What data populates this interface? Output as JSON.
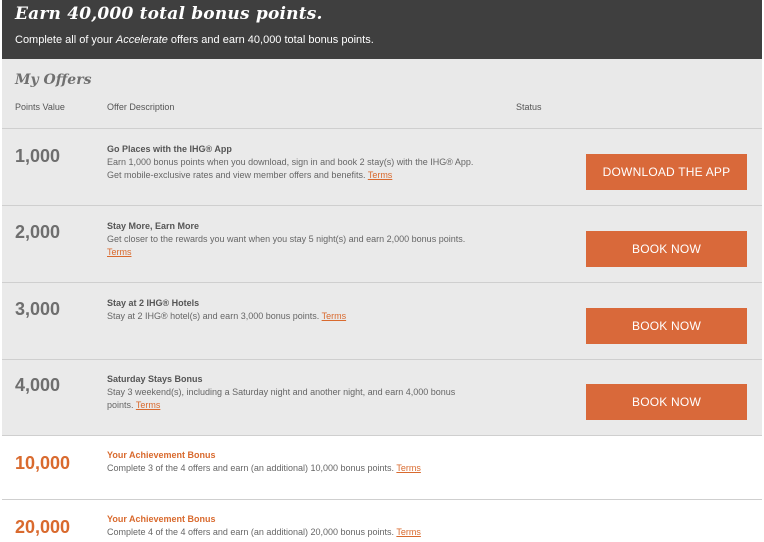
{
  "hero": {
    "title": "Earn 40,000 total bonus points.",
    "subtitle_pre": "Complete all of your ",
    "subtitle_em": "Accelerate",
    "subtitle_post": " offers and earn 40,000 total bonus points."
  },
  "offers": {
    "heading": "My Offers",
    "columns": {
      "points": "Points Value",
      "description": "Offer Description",
      "status": "Status"
    },
    "terms_label": "Terms",
    "rows": [
      {
        "points": "1,000",
        "title": "Go Places with the IHG® App",
        "description": "Earn 1,000 bonus points when you download, sign in and book 2 stay(s) with the IHG® App. Get mobile-exclusive rates and view member offers and benefits.",
        "button": "Download the App"
      },
      {
        "points": "2,000",
        "title": "Stay More, Earn More",
        "description": "Get closer to the rewards you want when you stay 5 night(s) and earn 2,000 bonus points.",
        "button": "Book Now"
      },
      {
        "points": "3,000",
        "title": "Stay at 2 IHG® Hotels",
        "description": "Stay at 2 IHG® hotel(s) and earn 3,000 bonus points.",
        "button": "Book Now"
      },
      {
        "points": "4,000",
        "title": "Saturday Stays Bonus",
        "description": "Stay 3 weekend(s), including a Saturday night and another night, and earn 4,000 bonus points.",
        "button": "Book Now"
      }
    ],
    "achievements": [
      {
        "points": "10,000",
        "title": "Your Achievement Bonus",
        "description": "Complete 3 of the 4 offers and earn (an additional) 10,000 bonus points."
      },
      {
        "points": "20,000",
        "title": "Your Achievement Bonus",
        "description": "Complete 4 of the 4 offers and earn (an additional) 20,000 bonus points."
      }
    ]
  },
  "colors": {
    "accent": "#d9693a",
    "header_bg": "#3f3f3f",
    "row_grey": "#eaeaea"
  }
}
